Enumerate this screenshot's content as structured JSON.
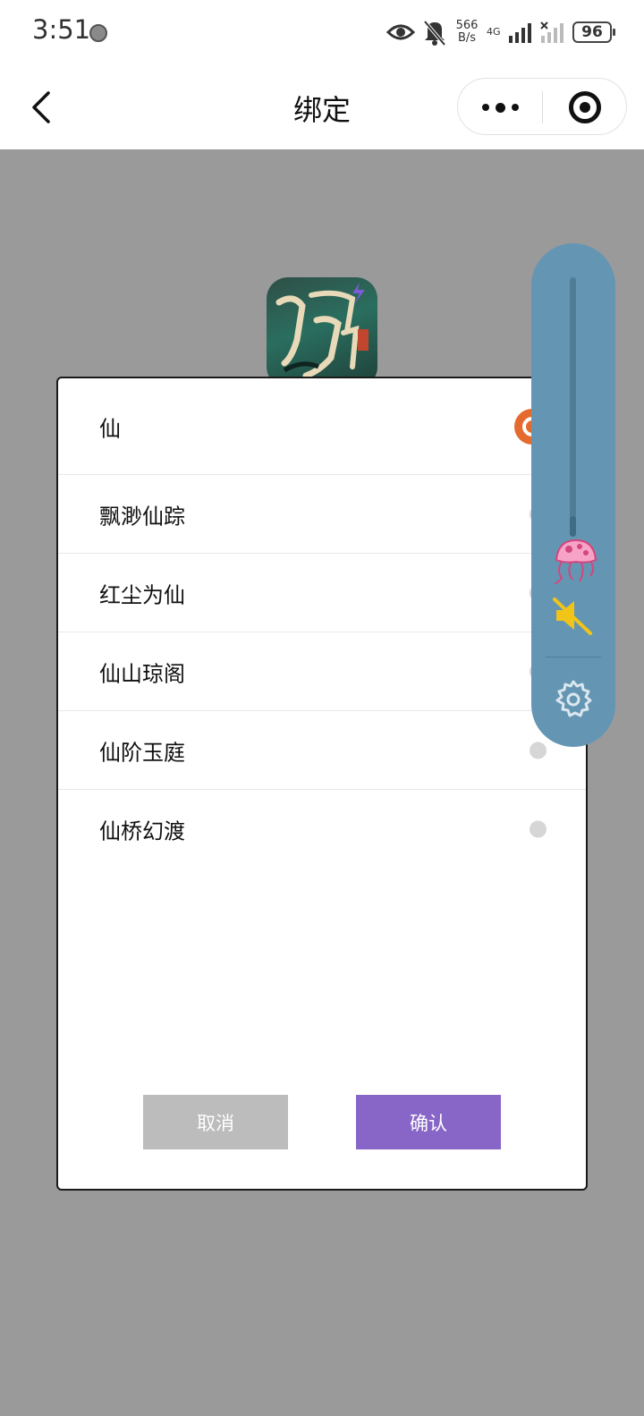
{
  "status_bar": {
    "time": "3:51",
    "net_speed_value": "566",
    "net_speed_unit": "B/s",
    "network_type": "4G",
    "battery": "96"
  },
  "nav": {
    "title": "绑定"
  },
  "dialog": {
    "servers": [
      {
        "name": "仙",
        "selected": true
      },
      {
        "name": "飘渺仙踪",
        "selected": false
      },
      {
        "name": "红尘为仙",
        "selected": false
      },
      {
        "name": "仙山琼阁",
        "selected": false
      },
      {
        "name": "仙阶玉庭",
        "selected": false
      },
      {
        "name": "仙桥幻渡",
        "selected": false
      }
    ],
    "cancel_label": "取消",
    "confirm_label": "确认"
  },
  "float_panel": {
    "volume_level": 0.08,
    "muted": true
  },
  "colors": {
    "overlay": "#9a9a9a",
    "accent_selected": "#e56a2e",
    "confirm_button": "#8766c7",
    "cancel_button": "#bcbcbc",
    "float_panel": "#6496b3"
  }
}
